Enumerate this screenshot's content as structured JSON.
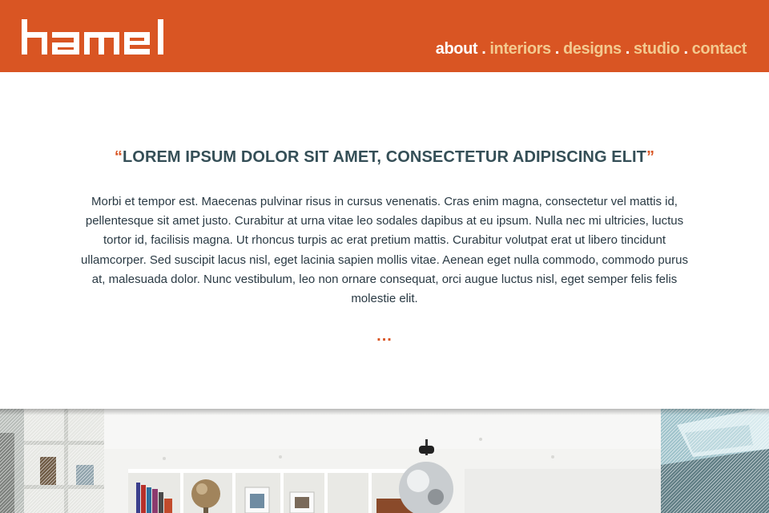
{
  "brand": {
    "accent_color": "#d95523",
    "logo_text": "hamel"
  },
  "nav": {
    "items": [
      {
        "label": "about",
        "active": true
      },
      {
        "label": "interiors",
        "active": false
      },
      {
        "label": "designs",
        "active": false
      },
      {
        "label": "studio",
        "active": false
      },
      {
        "label": "contact",
        "active": false
      }
    ],
    "separator": "."
  },
  "main": {
    "quote_open": "“",
    "quote": "LOREM IPSUM DOLOR SIT AMET, CONSECTETUR ADIPISCING ELIT",
    "quote_close": "”",
    "body": "Morbi et tempor est. Maecenas pulvinar risus in cursus venenatis. Cras enim magna, consectetur vel mattis id, pellentesque sit amet justo. Curabitur at urna vitae leo sodales dapibus at eu ipsum. Nulla nec mi ultricies, luctus tortor id, facilisis magna. Ut rhoncus turpis ac erat pretium mattis. Curabitur volutpat erat ut libero tincidunt ullamcorper. Sed suscipit lacus nisl, eget lacinia sapien mollis vitae. Aenean eget nulla commodo, commodo purus at, malesuada dolor. Nunc vestibulum, leo non ornare consequat, orci augue luctus nisl, eget semper felis felis molestie elit.",
    "more": "..."
  },
  "gallery": {
    "images": [
      "interior-shelving-photo",
      "living-room-disco-ball-photo",
      "ceiling-skylight-photo"
    ]
  }
}
